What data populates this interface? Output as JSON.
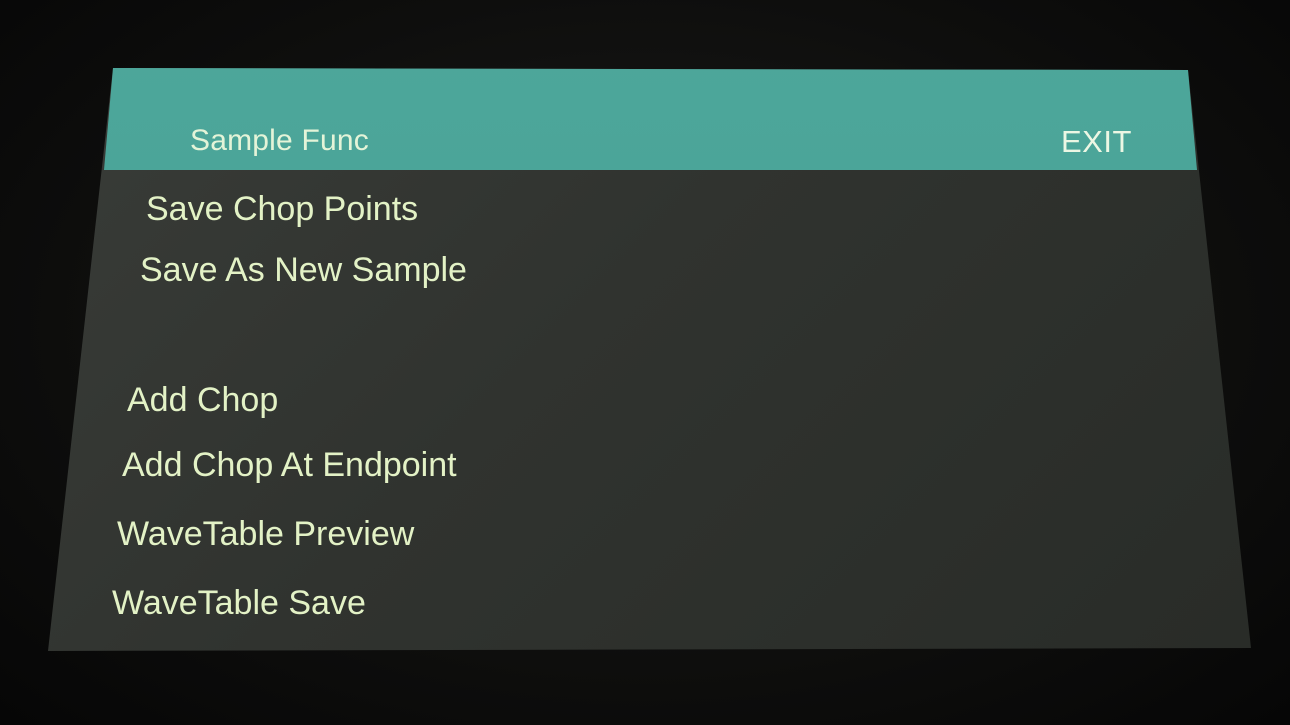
{
  "header": {
    "title": "Sample Func",
    "exit_label": "EXIT"
  },
  "menu": {
    "items": [
      {
        "label": "Save Chop Points"
      },
      {
        "label": "Save As New Sample"
      },
      {
        "label": "Add Chop"
      },
      {
        "label": "Add Chop At Endpoint"
      },
      {
        "label": "WaveTable Preview"
      },
      {
        "label": "WaveTable Save"
      }
    ]
  },
  "colors": {
    "header_bg": "#47a296",
    "screen_bg": "#33362f",
    "text": "#e3f2c6"
  }
}
